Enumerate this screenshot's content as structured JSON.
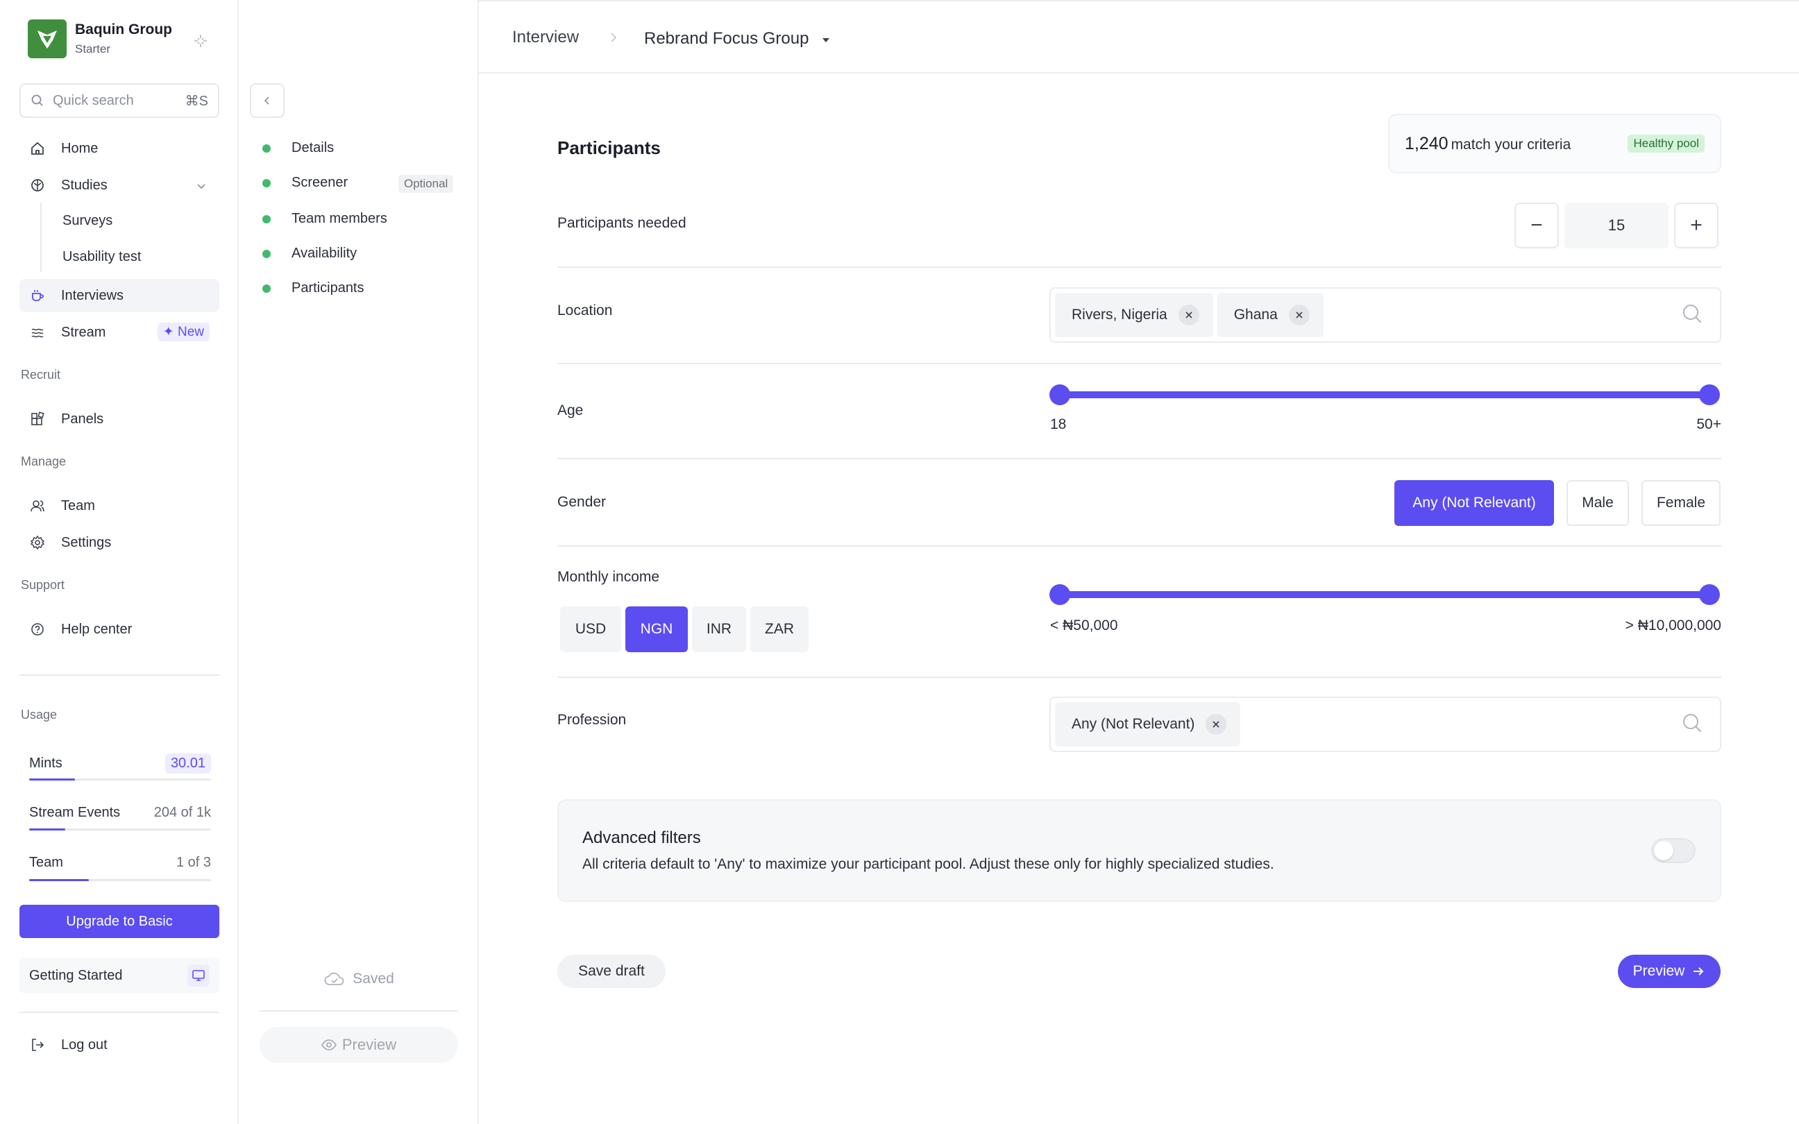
{
  "brand": {
    "name": "Baquin Group",
    "plan": "Starter"
  },
  "search": {
    "placeholder": "Quick search",
    "shortcut": "⌘S"
  },
  "nav": {
    "home": "Home",
    "studies": "Studies",
    "surveys": "Surveys",
    "usability": "Usability test",
    "interviews": "Interviews",
    "stream": "Stream",
    "stream_badge": "✦ New",
    "recruit_header": "Recruit",
    "panels": "Panels",
    "manage_header": "Manage",
    "team": "Team",
    "settings": "Settings",
    "support_header": "Support",
    "help": "Help center"
  },
  "usage": {
    "header": "Usage",
    "items": [
      {
        "name": "Mints",
        "value": "30.01",
        "progress": 0.25
      },
      {
        "name": "Stream Events",
        "value": "204 of 1k",
        "progress": 0.2
      },
      {
        "name": "Team",
        "value": "1 of 3",
        "progress": 0.33
      }
    ]
  },
  "upgrade_label": "Upgrade to Basic",
  "getting_started": "Getting Started",
  "logout": "Log out",
  "steps": {
    "items": [
      "Details",
      "Screener",
      "Team members",
      "Availability",
      "Participants"
    ],
    "optional_badge": "Optional",
    "saved": "Saved",
    "preview": "Preview"
  },
  "breadcrumb": {
    "section": "Interview",
    "study": "Rebrand Focus Group"
  },
  "participants": {
    "title": "Participants",
    "match_count": "1,240",
    "match_text": "match your criteria",
    "pool_status": "Healthy pool",
    "needed_label": "Participants needed",
    "needed_value": "15",
    "minus": "−",
    "plus": "+",
    "location_label": "Location",
    "locations": [
      "Rivers, Nigeria",
      "Ghana"
    ],
    "age_label": "Age",
    "age_min": "18",
    "age_max": "50+",
    "gender_label": "Gender",
    "gender_options": [
      "Any (Not Relevant)",
      "Male",
      "Female"
    ],
    "gender_selected": "Any (Not Relevant)",
    "income_label": "Monthly income",
    "currencies": [
      "USD",
      "NGN",
      "INR",
      "ZAR"
    ],
    "currency_selected": "NGN",
    "income_min": "< ₦50,000",
    "income_max": "> ₦10,000,000",
    "profession_label": "Profession",
    "professions": [
      "Any (Not Relevant)"
    ],
    "advanced_title": "Advanced filters",
    "advanced_desc": "All criteria default to 'Any' to maximize your participant pool. Adjust these only for highly specialized studies.",
    "advanced_enabled": false,
    "save_draft": "Save draft",
    "preview": "Preview"
  },
  "colors": {
    "accent": "#5b4df0",
    "success": "#3dbb6b",
    "brand": "#3f8f3f"
  }
}
